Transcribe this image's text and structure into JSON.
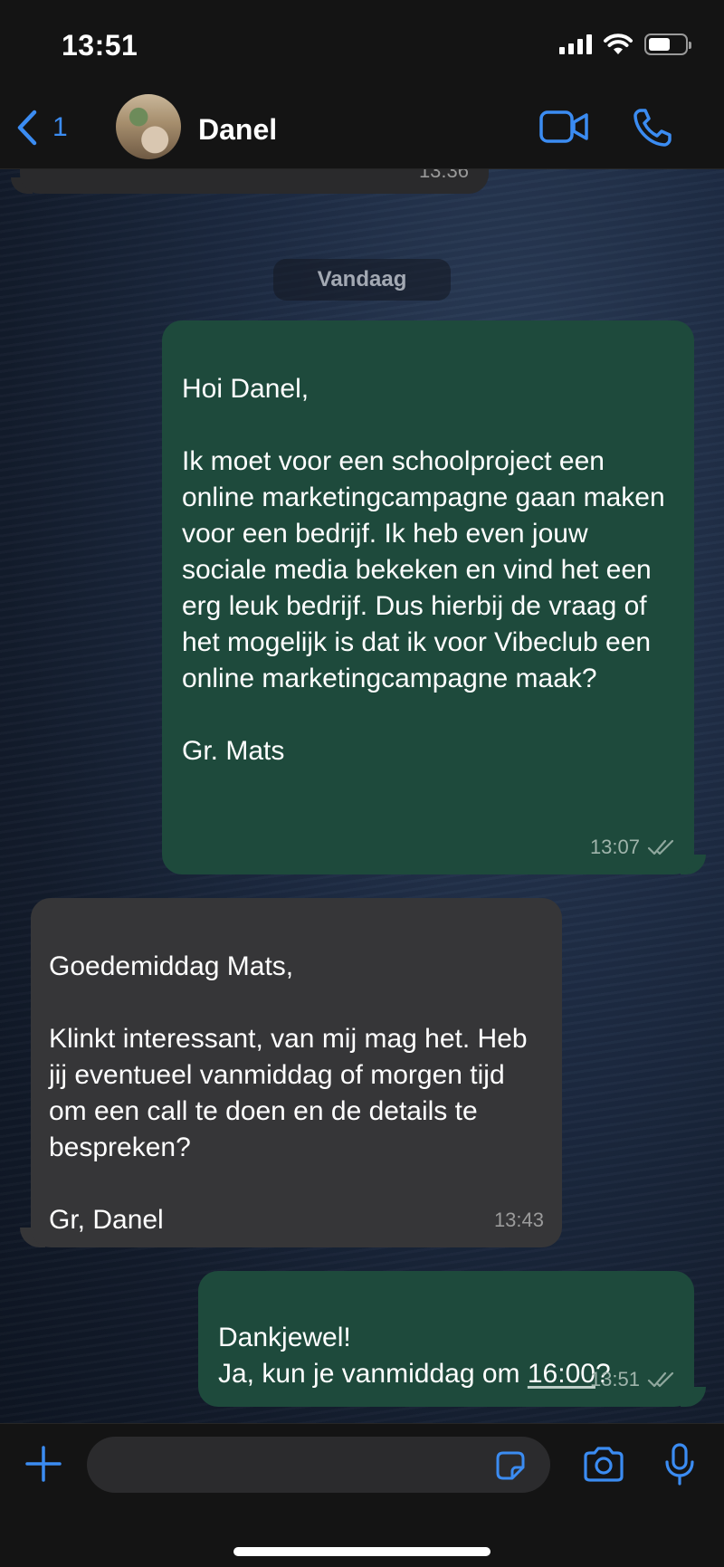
{
  "status_bar": {
    "time": "13:51",
    "battery_level": 0.6
  },
  "header": {
    "back_count": "1",
    "contact_name": "Danel",
    "accent_color": "#3b8cf2",
    "icons": [
      "chevron-left-icon",
      "video-camera-icon",
      "phone-icon"
    ]
  },
  "chat": {
    "previous_message_time": "13:36",
    "day_label": "Vandaag",
    "messages": [
      {
        "direction": "outgoing",
        "text": "Hoi Danel,\n\nIk moet voor een schoolproject een online marketingcampagne gaan maken voor een bedrijf. Ik heb even jouw sociale media bekeken en vind het een erg leuk bedrijf. Dus hierbij de vraag of het mogelijk is dat ik voor Vibeclub een online marketingcampagne maak?\n\nGr. Mats",
        "time": "13:07",
        "status": "read"
      },
      {
        "direction": "incoming",
        "text": "Goedemiddag Mats,\n\nKlinkt interessant, van mij mag het. Heb jij eventueel vanmiddag of morgen tijd om een call te doen en de details te bespreken?\n\nGr, Danel",
        "time": "13:43"
      },
      {
        "direction": "outgoing",
        "text_line1": "Dankjewel!",
        "text_line2_prefix": "Ja, kun je vanmiddag om ",
        "text_line2_link": "16:00",
        "text_line2_suffix": "?",
        "time": "13:51",
        "status": "read"
      }
    ]
  },
  "composer": {
    "value": "",
    "icons": [
      "plus-icon",
      "sticker-icon",
      "camera-icon",
      "microphone-icon"
    ]
  },
  "colors": {
    "outgoing_bubble": "#1e4a3c",
    "incoming_bubble": "#363638",
    "bar_background": "#141414"
  }
}
